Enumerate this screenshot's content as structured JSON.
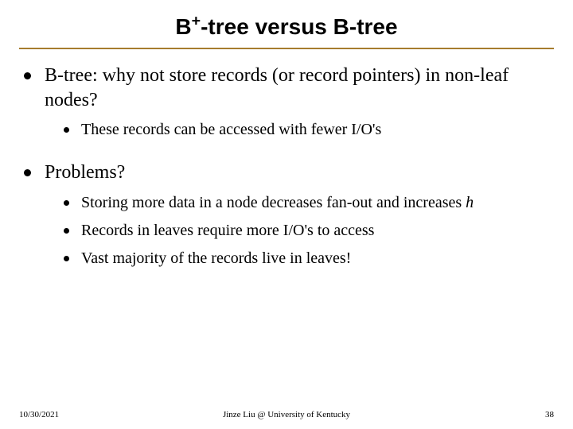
{
  "title_parts": {
    "pre": "B",
    "sup": "+",
    "post": "-tree versus B-tree"
  },
  "bullets": [
    {
      "text": "B-tree: why not store records (or record pointers) in non-leaf nodes?",
      "children": [
        {
          "text": "These records can be accessed with fewer I/O's"
        }
      ]
    },
    {
      "text": "Problems?",
      "children": [
        {
          "text_pre": "Storing more data in a node decreases fan-out and increases ",
          "italic": "h"
        },
        {
          "text": "Records in leaves require more I/O's to access"
        },
        {
          "text": "Vast majority of the records live in leaves!"
        }
      ]
    }
  ],
  "footer": {
    "date": "10/30/2021",
    "attribution": "Jinze Liu @ University of Kentucky",
    "page": "38"
  }
}
